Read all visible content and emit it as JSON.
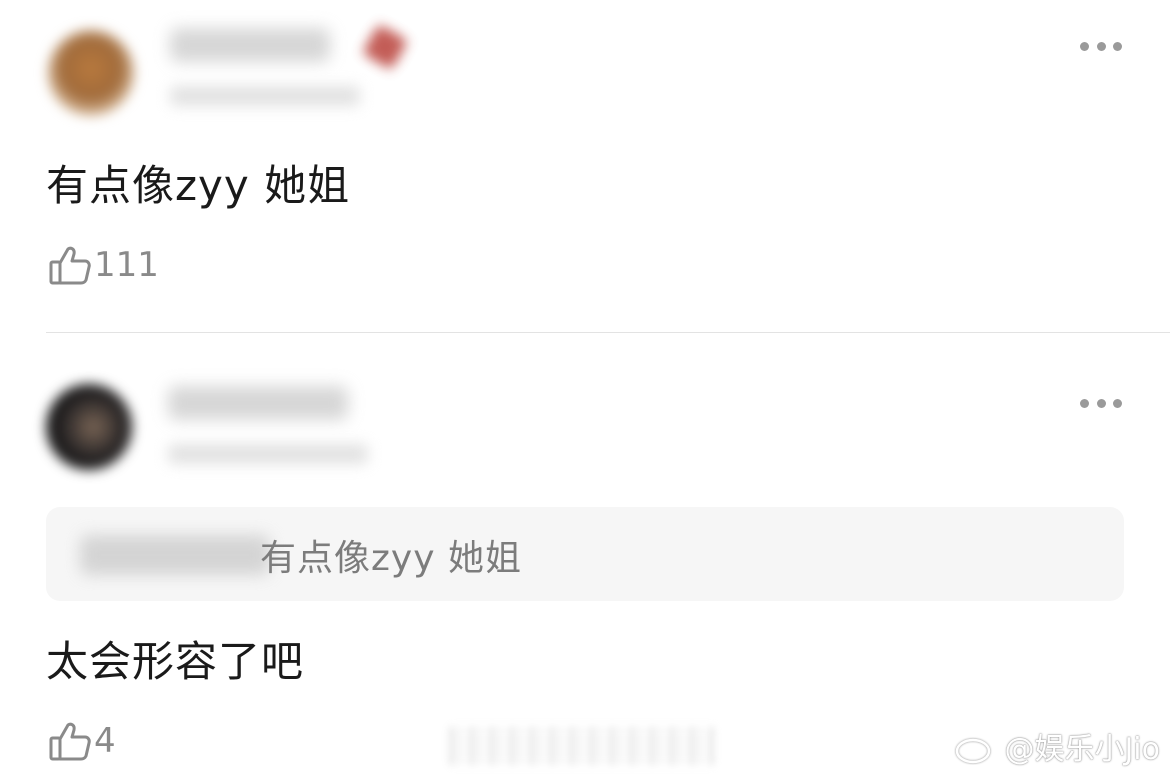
{
  "comments": [
    {
      "text": "有点像zyy 她姐",
      "likes": "111",
      "avatar_icon": "avatar-blurred",
      "username_blurred": true
    },
    {
      "text": "太会形容了吧",
      "likes": "4",
      "avatar_icon": "avatar-blurred",
      "username_blurred": true,
      "quoted_reply": "有点像zyy 她姐"
    }
  ],
  "more_icon": "ellipsis-icon",
  "like_icon": "thumbs-up-icon",
  "watermark": {
    "text": "@娱乐小Jio",
    "icon": "weibo-logo-icon"
  },
  "colors": {
    "text": "#1a1a1a",
    "secondary": "#8a8a8a",
    "quote_bg": "#f6f6f6",
    "divider": "#e3e3e3"
  }
}
